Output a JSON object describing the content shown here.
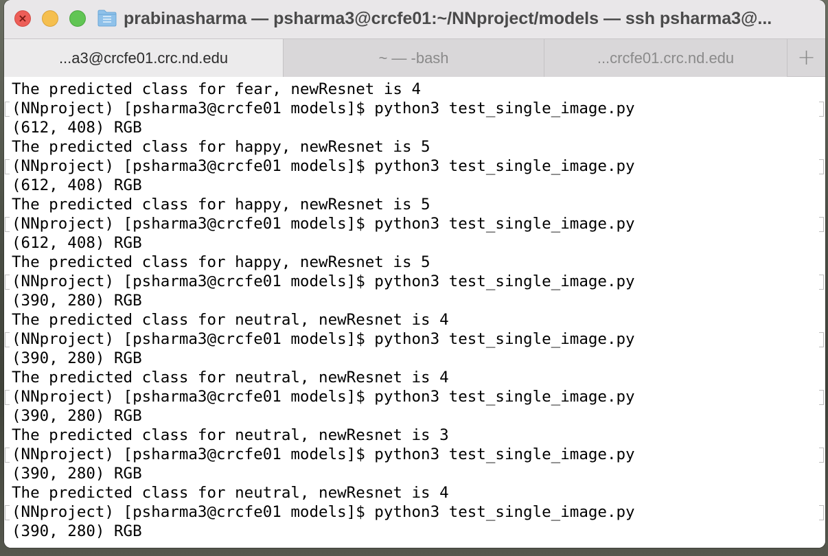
{
  "window": {
    "title": "prabinasharma — psharma3@crcfe01:~/NNproject/models — ssh psharma3@..."
  },
  "icons": {
    "close": "close-icon",
    "folder": "folder-icon",
    "new_tab": "plus-icon"
  },
  "colors": {
    "close": "#ed5e58",
    "minimize": "#f5bf4f",
    "maximize": "#61c554"
  },
  "tabs": [
    {
      "label": "...a3@crcfe01.crc.nd.edu",
      "active": true
    },
    {
      "label": "~ — -bash",
      "active": false
    },
    {
      "label": "...crcfe01.crc.nd.edu",
      "active": false
    }
  ],
  "new_tab_label": "+",
  "terminal": {
    "lines": [
      {
        "text": "The predicted class for fear, newResnet is 4",
        "prompt": false
      },
      {
        "text": "(NNproject) [psharma3@crcfe01 models]$ python3 test_single_image.py",
        "prompt": true
      },
      {
        "text": "(612, 408) RGB",
        "prompt": false
      },
      {
        "text": "The predicted class for happy, newResnet is 5",
        "prompt": false
      },
      {
        "text": "(NNproject) [psharma3@crcfe01 models]$ python3 test_single_image.py",
        "prompt": true
      },
      {
        "text": "(612, 408) RGB",
        "prompt": false
      },
      {
        "text": "The predicted class for happy, newResnet is 5",
        "prompt": false
      },
      {
        "text": "(NNproject) [psharma3@crcfe01 models]$ python3 test_single_image.py",
        "prompt": true
      },
      {
        "text": "(612, 408) RGB",
        "prompt": false
      },
      {
        "text": "The predicted class for happy, newResnet is 5",
        "prompt": false
      },
      {
        "text": "(NNproject) [psharma3@crcfe01 models]$ python3 test_single_image.py",
        "prompt": true
      },
      {
        "text": "(390, 280) RGB",
        "prompt": false
      },
      {
        "text": "The predicted class for neutral, newResnet is 4",
        "prompt": false
      },
      {
        "text": "(NNproject) [psharma3@crcfe01 models]$ python3 test_single_image.py",
        "prompt": true
      },
      {
        "text": "(390, 280) RGB",
        "prompt": false
      },
      {
        "text": "The predicted class for neutral, newResnet is 4",
        "prompt": false
      },
      {
        "text": "(NNproject) [psharma3@crcfe01 models]$ python3 test_single_image.py",
        "prompt": true
      },
      {
        "text": "(390, 280) RGB",
        "prompt": false
      },
      {
        "text": "The predicted class for neutral, newResnet is 3",
        "prompt": false
      },
      {
        "text": "(NNproject) [psharma3@crcfe01 models]$ python3 test_single_image.py",
        "prompt": true
      },
      {
        "text": "(390, 280) RGB",
        "prompt": false
      },
      {
        "text": "The predicted class for neutral, newResnet is 4",
        "prompt": false
      },
      {
        "text": "(NNproject) [psharma3@crcfe01 models]$ python3 test_single_image.py",
        "prompt": true
      },
      {
        "text": "(390, 280) RGB",
        "prompt": false
      }
    ]
  }
}
